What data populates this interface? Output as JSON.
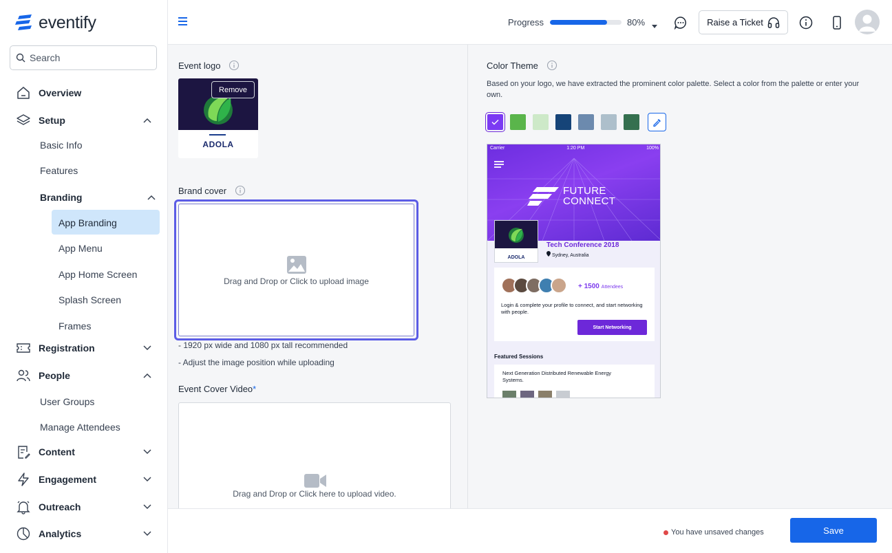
{
  "app": {
    "name": "eventify"
  },
  "sidebar": {
    "search_placeholder": "Search",
    "overview": "Overview",
    "setup": "Setup",
    "basic_info": "Basic Info",
    "features": "Features",
    "branding": "Branding",
    "app_branding": "App Branding",
    "app_menu": "App Menu",
    "app_home_screen": "App Home Screen",
    "splash_screen": "Splash Screen",
    "frames": "Frames",
    "registration": "Registration",
    "people": "People",
    "user_groups": "User Groups",
    "manage_attendees": "Manage Attendees",
    "content": "Content",
    "engagement": "Engagement",
    "outreach": "Outreach",
    "analytics": "Analytics"
  },
  "header": {
    "progress_label": "Progress",
    "progress_value": 0.8,
    "progress_text": "80%",
    "raise_ticket": "Raise a Ticket"
  },
  "left_panel": {
    "event_logo": "Event logo",
    "remove": "Remove",
    "logo_wordmark": "ADOLA",
    "brand_cover": "Brand cover",
    "cover_upload": "Drag and Drop or Click to upload image",
    "hint1": "- 1920 px wide and 1080 px tall recommended",
    "hint2": "- Adjust the image position while uploading",
    "video_title": "Event Cover Video",
    "video_required": "*",
    "video_upload": "Drag and Drop or Click here to upload video."
  },
  "right_panel": {
    "title": "Color Theme",
    "description": "Based on your logo, we have extracted the prominent color palette. Select a color from the palette or enter your own.",
    "swatches": [
      "#7b3af3",
      "#5ab54b",
      "#cde9c8",
      "#164478",
      "#6c8aae",
      "#adbfcb",
      "#35704f"
    ],
    "selected_swatch": 0
  },
  "phone_preview": {
    "carrier": "Carrier",
    "time": "1:20 PM",
    "battery": "100%",
    "brand_line1": "FUTURE",
    "brand_line2": "CONNECT",
    "logo_wordmark": "ADOLA",
    "event_name": "Tech Conference 2018",
    "location": "Sydney, Australia",
    "attendees_count": "+ 1500",
    "attendees_label": "Attendees",
    "copy": "Login & complete your profile to connect, and start networking with people.",
    "cta": "Start Networking",
    "featured": "Featured Sessions",
    "session_title": "Next Generation Distributed Renewable Energy Systems."
  },
  "footer": {
    "unsaved": "You have unsaved changes",
    "save": "Save"
  }
}
